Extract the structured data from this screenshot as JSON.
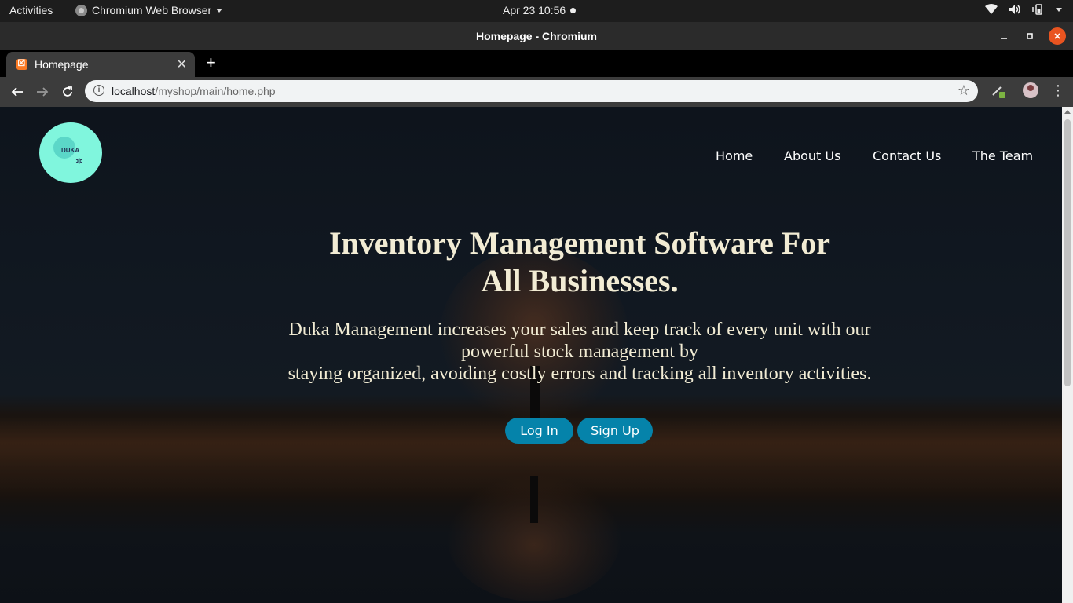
{
  "system": {
    "activities": "Activities",
    "app_name": "Chromium Web Browser",
    "clock": "Apr 23  10:56"
  },
  "window": {
    "title": "Homepage - Chromium"
  },
  "tabs": [
    {
      "label": "Homepage"
    }
  ],
  "address_bar": {
    "host": "localhost",
    "path": "/myshop/main/home.php"
  },
  "page": {
    "logo_text": "DUKA",
    "nav": [
      "Home",
      "About Us",
      "Contact Us",
      "The Team"
    ],
    "hero": {
      "title_line1": "Inventory Management Software For",
      "title_line2": "All Businesses.",
      "text_line1": "Duka Management increases your sales and keep track of every unit with our",
      "text_line2": "powerful stock management by",
      "text_line3": "staying organized, avoiding costly errors and tracking all inventory activities."
    },
    "buttons": {
      "login": "Log In",
      "signup": "Sign Up"
    }
  },
  "colors": {
    "accent_button": "#0583aa",
    "logo_circle": "#80f6dd",
    "hero_text": "#f2ecd4",
    "window_close": "#e95420"
  }
}
